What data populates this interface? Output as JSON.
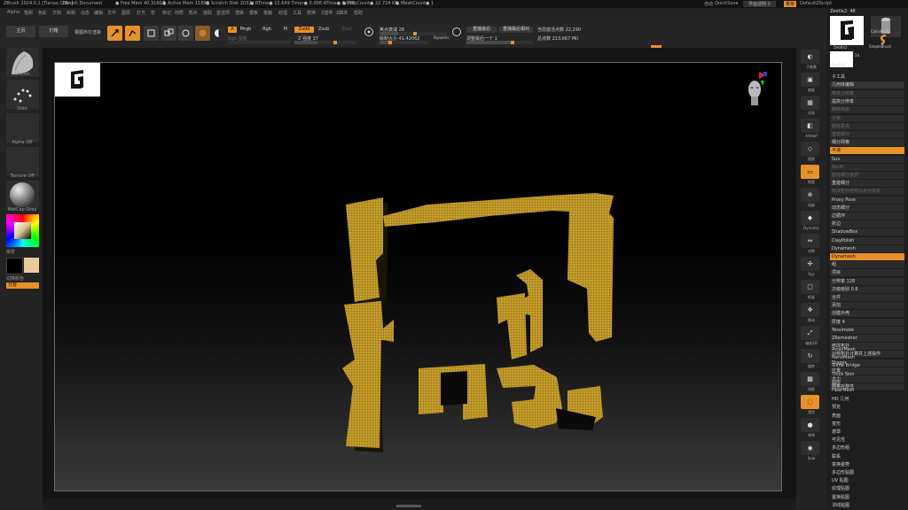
{
  "titlebar": {
    "app": "ZBrush 2024.0.1 [Tianao Chen]",
    "doc": "ZBrush Document",
    "free_mem": "● Free Mem 40.316GB",
    "active_mem": "● Active Mem 11890",
    "scratch": "● Scratch Disk 2032",
    "rtime": "● RTime● 12.649 Timer● 0.008 ATime● 0.008",
    "poly": "● PolyCount● 22.724 KP",
    "mesh": "● MeshCount● 1",
    "auto": "自动",
    "quicksave": "QuickSave",
    "transparency": "界面透明 0",
    "menus": "菜单",
    "default_script": "DefaultZScript"
  },
  "menubar": [
    "Alpha",
    "笔刷",
    "色彩",
    "文档",
    "绘制",
    "动态",
    "编辑",
    "文件",
    "图层",
    "灯光",
    "宏",
    "标记",
    "材质",
    "影片",
    "拾取",
    "首选项",
    "渲染",
    "模板",
    "笔触",
    "纹理",
    "工具",
    "变换",
    "Z插件",
    "Z脚本",
    "帮助"
  ],
  "topshelf": {
    "home": "主页",
    "lightbox": "灯箱",
    "spotlight": "梗图布尔渲染",
    "edit": "Edit",
    "draw": "Draw",
    "move": "Move",
    "scale": "Scale",
    "rotate": "Rotate",
    "a": "A",
    "mrgb": "Mrgb",
    "rgb": "Rgb",
    "m": "M",
    "zadd": "Zadd",
    "zsub": "Zsub",
    "zcut": "Zcut",
    "rgb_intensity": "Rgb 强度",
    "z_intensity": "Z 强度 37",
    "focal_shift": "焦点衰减 28",
    "draw_size": "绘制大小 41.42062",
    "dynamic": "Dynamic",
    "replay_last": "重播最后",
    "replay_last_rel": "重播最后相对",
    "adjust_last": "调整最后一个 1",
    "active_points": "当前激活点数 22,290",
    "total_points": "总点数 213,667 Mil"
  },
  "leftshelf": {
    "brush": "hPolish",
    "stroke": "Dots",
    "alpha": "Alpha Off",
    "texture": "Texture Off",
    "material": "MatCap Gray",
    "gradient": "渐变",
    "switch_color": "切换颜色",
    "alternate": "交替"
  },
  "rightshelf": [
    "子像素",
    "缩放",
    "实际",
    "AAHalf",
    "透视",
    "地面",
    "局部",
    "Dynamic",
    "对称",
    "Xyz",
    "框架",
    "移动",
    "缩放3D",
    "旋转",
    "线框",
    "透明",
    "单独",
    "Solo"
  ],
  "toolpanel": {
    "tool_name": "Zeotlx2: 48",
    "thumb1": "Zeotlx2",
    "thumb2": "Cylinder3D",
    "thumb3": "SimpleBrush",
    "thumb4": "Zeotlx2",
    "thumb_count": "24",
    "subtool": "子工具",
    "geometry": "几何体编辑",
    "items": [
      {
        "label": "降低分辨率",
        "dim": true
      },
      {
        "label": "提高分辨率",
        "dim": false
      },
      {
        "label": "删除低级",
        "dim": true
      },
      {
        "label": "分离",
        "dim": true
      },
      {
        "label": "删除更高",
        "dim": true
      },
      {
        "label": "重建细分",
        "dim": true
      },
      {
        "label": "细分网格",
        "dim": false
      },
      {
        "label": "平滑",
        "dim": false
      },
      {
        "label": "Suv",
        "dim": false
      },
      {
        "label": "ReUV",
        "dim": true
      },
      {
        "label": "删除细分级别",
        "dim": true
      },
      {
        "label": "重建细分",
        "dim": false
      },
      {
        "label": "修改拓扑结构以点为系统",
        "dim": true
      },
      {
        "label": "Proxy Pose",
        "dim": false
      },
      {
        "label": "动态细分",
        "dim": false
      },
      {
        "label": "边循环",
        "dim": false
      },
      {
        "label": "折边",
        "dim": false
      },
      {
        "label": "ShadowBox",
        "dim": false
      },
      {
        "label": "ClayPolish",
        "dim": false
      },
      {
        "label": "Dynamesh",
        "dim": false
      },
      {
        "label": "Dynamesh",
        "dim": false
      },
      {
        "label": "组",
        "dim": false
      },
      {
        "label": "项目",
        "dim": false
      },
      {
        "label": "分辨率 128",
        "dim": false
      },
      {
        "label": "次级级别 0.6",
        "dim": false
      },
      {
        "label": "合并",
        "dim": false
      },
      {
        "label": "添加",
        "dim": false
      },
      {
        "label": "创建外壳",
        "dim": false
      },
      {
        "label": "厚度 4",
        "dim": false
      },
      {
        "label": "Tessimate",
        "dim": false
      },
      {
        "label": "ZRemesher",
        "dim": false
      },
      {
        "label": "修改拓扑",
        "dim": false
      },
      {
        "label": "对称拓扑计算并上述操作",
        "dim": false
      },
      {
        "label": "Stager",
        "dim": false
      },
      {
        "label": "位置",
        "dim": false
      },
      {
        "label": "大小",
        "dim": false
      },
      {
        "label": "网格完整性",
        "dim": false
      }
    ],
    "bottom": [
      "ArrayMesh",
      "NanoMesh",
      "Slime Bridge",
      "Thick Skin",
      "图层",
      "FiberMesh",
      "HD 几何",
      "预览",
      "表面",
      "变形",
      "遮罩",
      "可见性",
      "多边形组",
      "联系",
      "变换姿势",
      "多边形贴图",
      "UV 贴图",
      "纹理贴图",
      "置换贴图",
      "法线贴图"
    ]
  },
  "colors": {
    "accent": "#e8902a",
    "mesh": "#c9a02a",
    "bg": "#000000"
  }
}
